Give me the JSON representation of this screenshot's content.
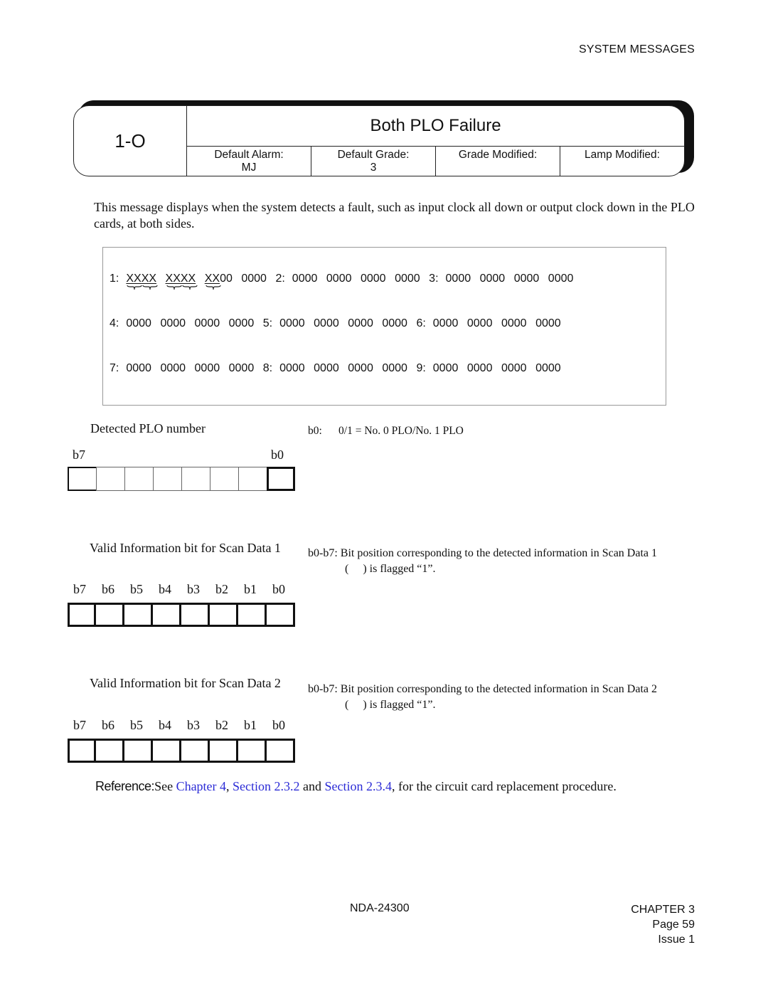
{
  "running_head": "SYSTEM MESSAGES",
  "header": {
    "id": "1-O",
    "title": "Both PLO Failure",
    "fields": [
      {
        "label": "Default Alarm:",
        "value": "MJ"
      },
      {
        "label": "Default Grade:",
        "value": "3"
      },
      {
        "label": "Grade Modified:",
        "value": ""
      },
      {
        "label": "Lamp Modified:",
        "value": ""
      }
    ]
  },
  "description": "This message displays when the system detects a fault, such as input clock all down or output clock down in the PLO cards, at both sides.",
  "scan_data": {
    "rows": [
      [
        {
          "label": "1:",
          "words": [
            "XXXX",
            "XXXX",
            "XX00",
            "0000"
          ]
        },
        {
          "label": "2:",
          "words": [
            "0000",
            "0000",
            "0000",
            "0000"
          ]
        },
        {
          "label": "3:",
          "words": [
            "0000",
            "0000",
            "0000",
            "0000"
          ]
        }
      ],
      [
        {
          "label": "4:",
          "words": [
            "0000",
            "0000",
            "0000",
            "0000"
          ]
        },
        {
          "label": "5:",
          "words": [
            "0000",
            "0000",
            "0000",
            "0000"
          ]
        },
        {
          "label": "6:",
          "words": [
            "0000",
            "0000",
            "0000",
            "0000"
          ]
        }
      ],
      [
        {
          "label": "7:",
          "words": [
            "0000",
            "0000",
            "0000",
            "0000"
          ]
        },
        {
          "label": "8:",
          "words": [
            "0000",
            "0000",
            "0000",
            "0000"
          ]
        },
        {
          "label": "9:",
          "words": [
            "0000",
            "0000",
            "0000",
            "0000"
          ]
        }
      ]
    ]
  },
  "blocks": [
    {
      "title": "Detected PLO number",
      "bit_labels": [
        "b7",
        "b0"
      ],
      "note_lines": [
        "b0:      0/1 = No. 0 PLO/No. 1 PLO"
      ]
    },
    {
      "title": "Valid Information bit for Scan Data 1",
      "bit_labels": [
        "b7",
        "b6",
        "b5",
        "b4",
        "b3",
        "b2",
        "b1",
        "b0"
      ],
      "note_lines": [
        "b0-b7: Bit position corresponding to the detected information in Scan Data 1",
        "(     ) is flagged “1”."
      ]
    },
    {
      "title": "Valid Information bit for Scan Data 2",
      "bit_labels": [
        "b7",
        "b6",
        "b5",
        "b4",
        "b3",
        "b2",
        "b1",
        "b0"
      ],
      "note_lines": [
        "b0-b7: Bit position corresponding to the detected information in Scan Data 2",
        "(     ) is flagged “1”."
      ]
    }
  ],
  "reference": {
    "label": "Reference:",
    "pre": "See ",
    "link1": "Chapter 4",
    "sep1": ", ",
    "link2": "Section 2.3.2",
    "mid": " and ",
    "link3": "Section 2.3.4",
    "post": ", for the circuit card replacement procedure.",
    "link_color": "#2b2bd6"
  },
  "footer": {
    "doc_number": "NDA-24300",
    "chapter": "CHAPTER 3",
    "page": "Page 59",
    "issue": "Issue 1"
  }
}
